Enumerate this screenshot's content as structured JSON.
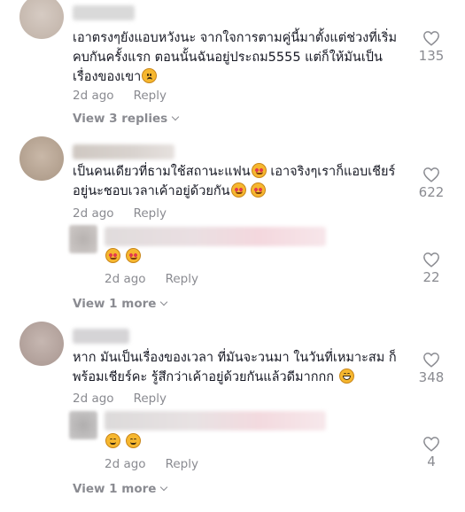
{
  "comments": [
    {
      "lines": [
        "เอาตรงๆยังแอบหวังนะ จากใจการตามคู่นี้มาตั้งแต่ช่วงที่เริ่ม",
        "คบกันครั้งแรก ตอนนั้นฉันอยู่ประถม5555 แต่ก็ให้มันเป็น",
        "เรื่องของเขา"
      ],
      "emoji": [
        "sad-face-icon"
      ],
      "date": "2d ago",
      "reply": "Reply",
      "likes": "135",
      "view_replies": "View 3 replies"
    },
    {
      "lines": [
        "เป็นคนเดียวที่ธามใช้สถานะแฟน",
        "อยู่นะชอบเวลาเค้าอยู่ด้วยกัน"
      ],
      "line1_tail": " เอาจริงๆเราก็แอบเชียร์",
      "date": "2d ago",
      "reply": "Reply",
      "likes": "622",
      "reply_item": {
        "date": "2d ago",
        "reply": "Reply",
        "likes": "22"
      },
      "view_replies": "View 1 more"
    },
    {
      "lines": [
        "หาก มันเป็นเรื่องของเวลา ที่มันจะวนมา ในวันที่เหมาะสม ก็",
        "พร้อมเชียร์คะ รู้สึกว่าเค้าอยู่ด้วยกันแล้วดีมากกก"
      ],
      "date": "2d ago",
      "reply": "Reply",
      "likes": "348",
      "reply_item": {
        "date": "2d ago",
        "reply": "Reply",
        "likes": "4"
      },
      "view_replies": "View 1 more"
    }
  ],
  "colors": {
    "text": "#161823",
    "muted": "#8a8b91",
    "emoji": "#f6b72f"
  }
}
